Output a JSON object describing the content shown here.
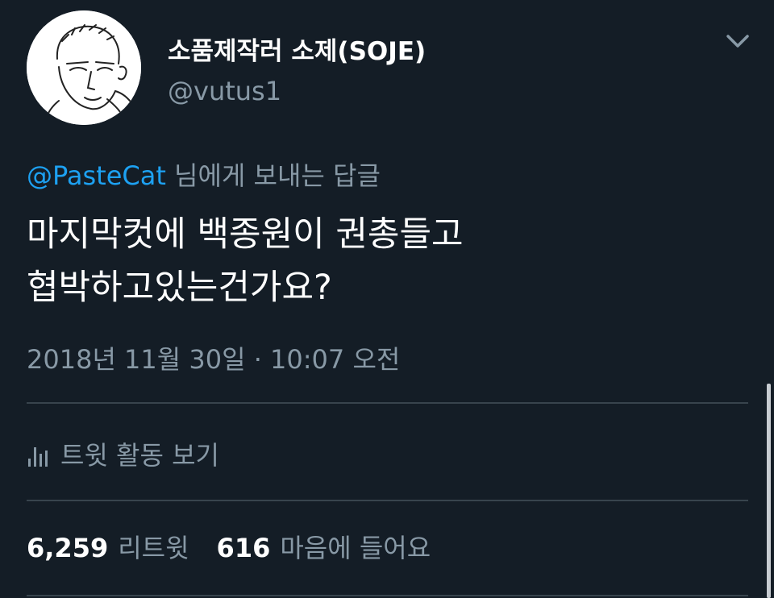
{
  "author": {
    "display_name": "소품제작러 소제(SOJE)",
    "handle": "@vutus1",
    "avatar_icon": "sketch-avatar"
  },
  "reply": {
    "mention": "@PasteCat",
    "suffix": " 님에게 보내는 답글"
  },
  "tweet": {
    "lines": [
      "마지막컷에 백종원이 권총들고",
      "협박하고있는건가요?"
    ],
    "timestamp": "2018년 11월 30일 · 10:07 오전"
  },
  "activity": {
    "label": "트윗 활동 보기",
    "icon": "bar-chart-icon"
  },
  "stats": {
    "retweets": "6,259",
    "retweets_label": "리트윗",
    "likes": "616",
    "likes_label": "마음에 들어요"
  },
  "colors": {
    "background": "#141d26",
    "secondary_text": "#8899a6",
    "link": "#1da1f2",
    "divider": "#38444d"
  }
}
